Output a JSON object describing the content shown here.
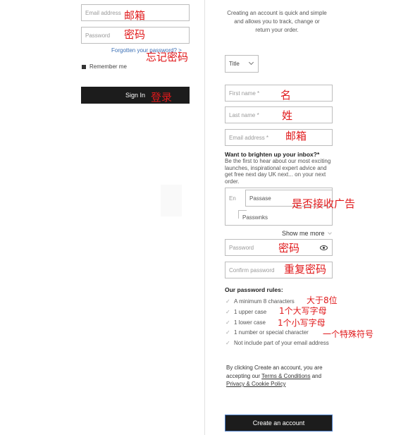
{
  "signin": {
    "email_placeholder": "Email address",
    "password_placeholder": "Password",
    "forgot_link": "Forgotten your password? >",
    "remember_label": "Remember me",
    "signin_button": "Sign In"
  },
  "register": {
    "intro": "Creating an account is quick and simple and allows you to track, change or return your order.",
    "title_select": "Title",
    "first_name_placeholder": "First name *",
    "last_name_placeholder": "Last name *",
    "email_placeholder": "Email address *",
    "marketing_heading": "Want to brighten up your inbox?*",
    "marketing_text": "Be the first to hear about our most exciting launches, inspirational expert advice and get free next day UK next... on your next order.",
    "overlay_text_1": "En",
    "overlay_text_2": "Passase",
    "overlay_text_3": "Passwnks",
    "show_more": "Show me more",
    "password_placeholder": "Password",
    "confirm_password_placeholder": "Confirm password",
    "rules_heading": "Our password rules:",
    "rules": [
      "A minimum 8 characters",
      "1 upper case",
      "1 lower case",
      "1 number or special character",
      "Not include part of your email address"
    ],
    "terms_prefix": "By clicking Create an account, you are accepting our",
    "terms_link": "Terms & Conditions",
    "terms_and": "and",
    "privacy_link": "Privacy & Cookie Policy",
    "create_button": "Create an account"
  },
  "annotations": {
    "email_left": "邮箱",
    "password_left": "密码",
    "forgot": "忘记密码",
    "signin": "登录",
    "first_name": "名",
    "last_name": "姓",
    "email_right": "邮箱",
    "marketing": "是否接收广告",
    "password_right": "密码",
    "confirm_password": "重复密码",
    "rule_min": "大于8位",
    "rule_upper": "1个大写字母",
    "rule_lower": "1个小写字母",
    "rule_special": "一个特殊符号"
  },
  "colors": {
    "annotation": "#e0191b",
    "button_dark": "#1c1c1c",
    "link_blue": "#3a6fb5"
  }
}
